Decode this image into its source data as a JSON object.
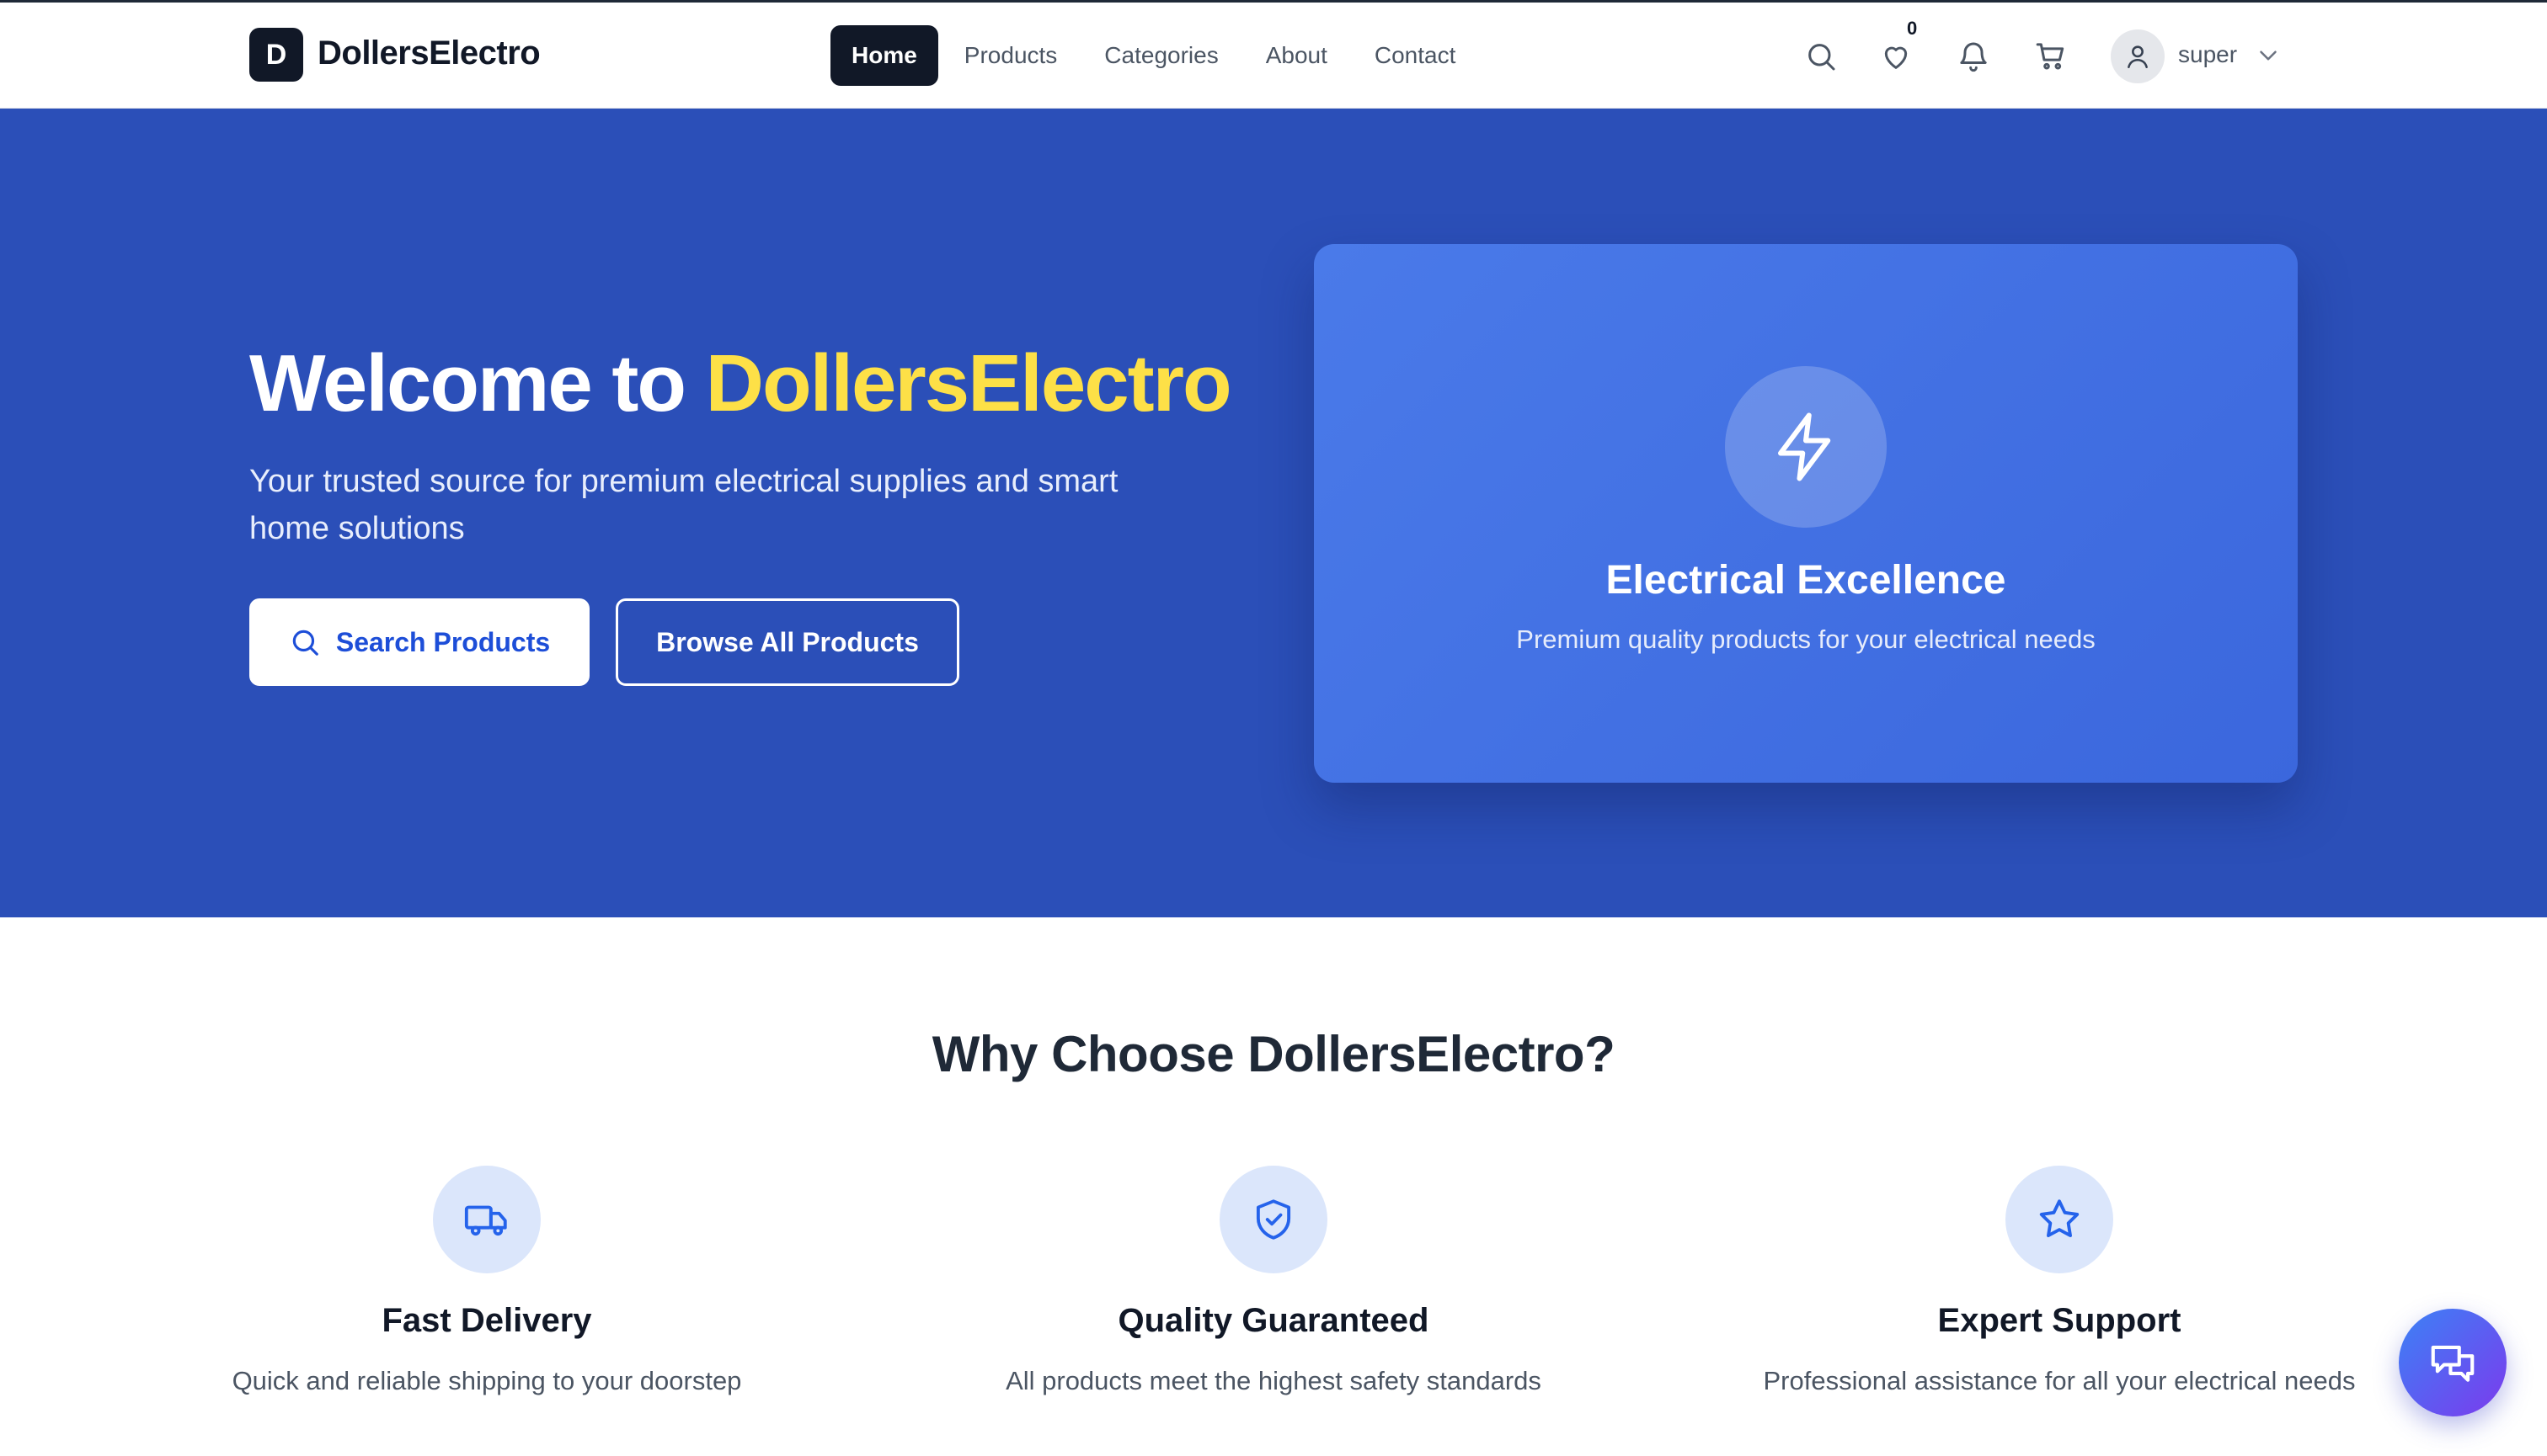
{
  "header": {
    "logo_letter": "D",
    "brand": "DollersElectro",
    "nav": [
      {
        "label": "Home",
        "active": true
      },
      {
        "label": "Products",
        "active": false
      },
      {
        "label": "Categories",
        "active": false
      },
      {
        "label": "About",
        "active": false
      },
      {
        "label": "Contact",
        "active": false
      }
    ],
    "icons": [
      "search-icon",
      "heart-icon",
      "bell-icon",
      "cart-icon"
    ],
    "wishlist_count": "0",
    "user": {
      "name": "super",
      "avatar_icon": "user-icon",
      "menu_icon": "chevron-down-icon"
    }
  },
  "hero": {
    "title_prefix": "Welcome to ",
    "title_accent": "DollersElectro",
    "subtitle": "Your trusted source for premium electrical supplies and smart home solutions",
    "search_button": "Search Products",
    "browse_button": "Browse All Products",
    "card": {
      "icon": "lightning-icon",
      "title": "Electrical Excellence",
      "subtitle": "Premium quality products for your electrical needs"
    },
    "colors": {
      "background": "#2b4fb8",
      "accent": "#fde047"
    }
  },
  "features": {
    "title": "Why Choose DollersElectro?",
    "items": [
      {
        "icon": "truck-icon",
        "title": "Fast Delivery",
        "description": "Quick and reliable shipping to your doorstep"
      },
      {
        "icon": "shield-check-icon",
        "title": "Quality Guaranteed",
        "description": "All products meet the highest safety standards"
      },
      {
        "icon": "star-icon",
        "title": "Expert Support",
        "description": "Professional assistance for all your electrical needs"
      }
    ]
  },
  "chat": {
    "icon": "chat-icon"
  }
}
